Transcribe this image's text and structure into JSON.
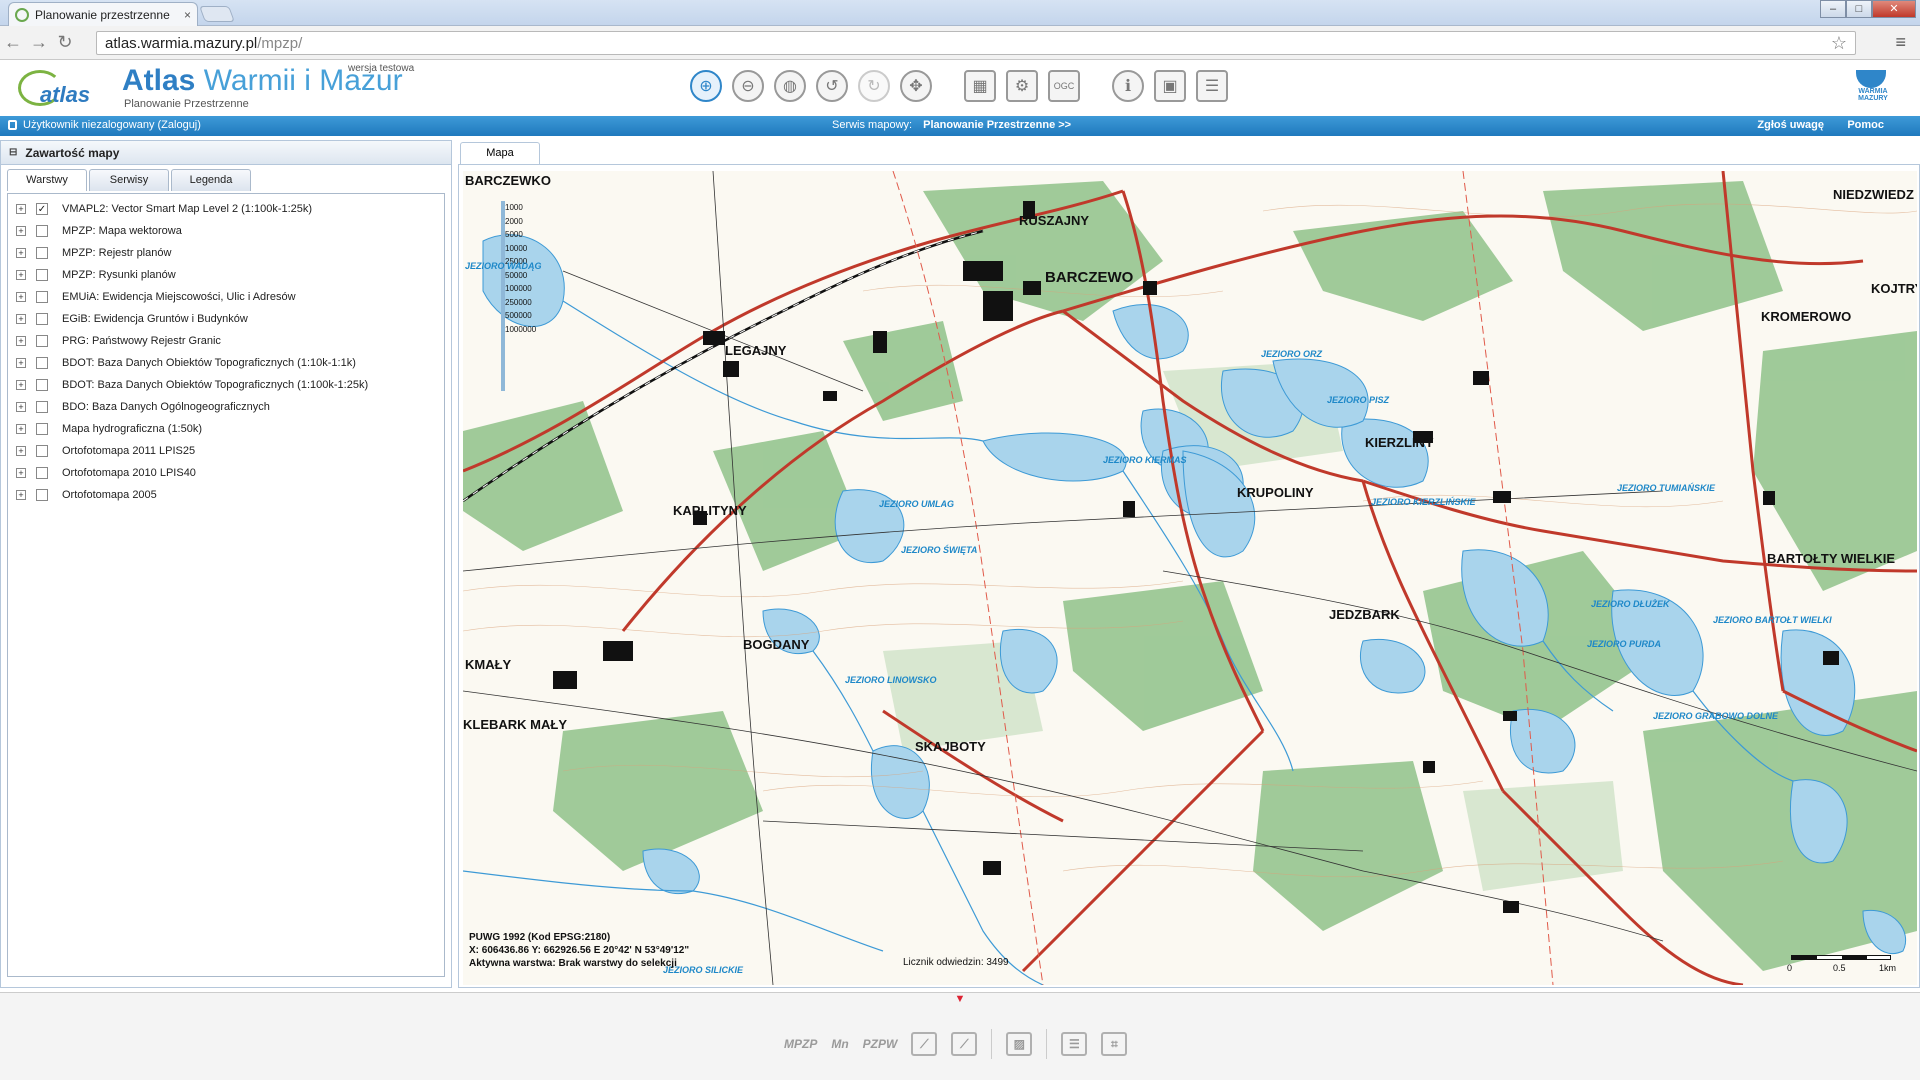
{
  "browser": {
    "tab_title": "Planowanie przestrzenne",
    "tab_close": "×",
    "url_host": "atlas.warmia.mazury.pl",
    "url_path": "/mpzp/",
    "back": "←",
    "forward": "→",
    "reload": "↻",
    "star": "☆",
    "menu": "≡",
    "win_min": "–",
    "win_max": "□",
    "win_close": "✕"
  },
  "header": {
    "logo_text": "atlas",
    "title_bold": "Atlas",
    "title_rest": "Warmii i Mazur",
    "subtitle": "Planowanie Przestrzenne",
    "beta": "wersja testowa",
    "brand_logo_text": "WARMIA MAZURY"
  },
  "tools": [
    {
      "name": "zoom-in-icon",
      "glyph": "⊕",
      "active": true
    },
    {
      "name": "zoom-out-icon",
      "glyph": "⊖",
      "active": false
    },
    {
      "name": "globe-icon",
      "glyph": "◍",
      "active": false
    },
    {
      "name": "history-back-icon",
      "glyph": "↺",
      "active": false
    },
    {
      "name": "history-forward-icon",
      "glyph": "↻",
      "active": false,
      "dim": true
    },
    {
      "name": "pan-icon",
      "glyph": "✥",
      "active": false
    },
    {
      "name": "print-icon",
      "glyph": "▦",
      "active": false
    },
    {
      "name": "settings-icon",
      "glyph": "⚙",
      "active": false
    },
    {
      "name": "ogc-icon",
      "glyph": "OGC",
      "active": false
    },
    {
      "name": "info-icon",
      "glyph": "ℹ",
      "active": false
    },
    {
      "name": "layers-grid-icon",
      "glyph": "▣",
      "active": false
    },
    {
      "name": "document-list-icon",
      "glyph": "☰",
      "active": false
    }
  ],
  "bluebar": {
    "user_status": "Użytkownik niezalogowany (Zaloguj)",
    "service_label": "Serwis mapowy:",
    "service_name": "Planowanie Przestrzenne >>",
    "report": "Zgłoś uwagę",
    "help": "Pomoc"
  },
  "panel": {
    "title": "Zawartość mapy",
    "collapse": "⊟",
    "tabs": [
      "Warstwy",
      "Serwisy",
      "Legenda"
    ],
    "layers": [
      {
        "label": "VMAPL2: Vector Smart Map Level 2 (1:100k-1:25k)",
        "checked": true
      },
      {
        "label": "MPZP: Mapa wektorowa",
        "checked": false
      },
      {
        "label": "MPZP: Rejestr planów",
        "checked": false
      },
      {
        "label": "MPZP: Rysunki planów",
        "checked": false
      },
      {
        "label": "EMUiA: Ewidencja Miejscowości, Ulic i Adresów",
        "checked": false
      },
      {
        "label": "EGiB: Ewidencja Gruntów i Budynków",
        "checked": false
      },
      {
        "label": "PRG: Państwowy Rejestr Granic",
        "checked": false
      },
      {
        "label": "BDOT: Baza Danych Obiektów Topograficznych (1:10k-1:1k)",
        "checked": false
      },
      {
        "label": "BDOT: Baza Danych Obiektów Topograficznych (1:100k-1:25k)",
        "checked": false
      },
      {
        "label": "BDO: Baza Danych Ogólnogeograficznych",
        "checked": false
      },
      {
        "label": "Mapa hydrograficzna (1:50k)",
        "checked": false
      },
      {
        "label": "Ortofotomapa 2011 LPIS25",
        "checked": false
      },
      {
        "label": "Ortofotomapa 2010 LPIS40",
        "checked": false
      },
      {
        "label": "Ortofotomapa 2005",
        "checked": false
      }
    ]
  },
  "map": {
    "tab": "Mapa",
    "places": [
      {
        "text": "BARCZEWKO",
        "big": false
      },
      {
        "text": "RUSZAJNY",
        "big": false
      },
      {
        "text": "BARCZEWO",
        "big": true
      },
      {
        "text": "NIEDZWIEDZ",
        "big": false
      },
      {
        "text": "KROMEROWO",
        "big": false
      },
      {
        "text": "KOJTRY",
        "big": false
      },
      {
        "text": "LEGAJNY",
        "big": false
      },
      {
        "text": "KIERZLINY",
        "big": false
      },
      {
        "text": "KRUPOLINY",
        "big": false
      },
      {
        "text": "KAPLITYNY",
        "big": false
      },
      {
        "text": "BARTOŁTY WIELKIE",
        "big": false
      },
      {
        "text": "JEDZBARK",
        "big": false
      },
      {
        "text": "KLEBARK MAŁY",
        "big": false
      },
      {
        "text": "SKAJBOTY",
        "big": false
      },
      {
        "text": "BOGDANY",
        "big": false
      },
      {
        "text": "KMAŁY",
        "big": false
      }
    ],
    "lakes": [
      "JEZIORO WADĄG",
      "JEZIORO ORZ",
      "JEZIORO PISZ",
      "JEZIORO KIERMAS",
      "JEZIORO KIERZLIŃSKIE",
      "JEZIORO UMLAG",
      "JEZIORO ŚWIĘTA",
      "JEZIORO LINOWSKO",
      "JEZIORO TUMIAŃSKIE",
      "JEZIORO DŁUŻEK",
      "JEZIORO BARTOŁT WIELKI",
      "JEZIORO PURDA",
      "JEZIORO SILICKIE",
      "JEZIORO GRABOWO DOLNE"
    ],
    "zoom_scales": [
      "1000",
      "2000",
      "5000",
      "10000",
      "25000",
      "50000",
      "100000",
      "250000",
      "500000",
      "1000000"
    ],
    "coords_line1": "PUWG 1992 (Kod EPSG:2180)",
    "coords_line2": "X: 606436.86  Y: 662926.56    E 20°42' N 53°49'12\"",
    "coords_line3": "Aktywna warstwa: Brak warstwy do selekcji",
    "counter": "Licznik odwiedzin: 3499",
    "scale_0": "0",
    "scale_05": "0.5",
    "scale_1": "1km"
  },
  "bottom": {
    "arrow": "▼",
    "tools": [
      "MPZP",
      "Mn",
      "PZPW"
    ]
  }
}
